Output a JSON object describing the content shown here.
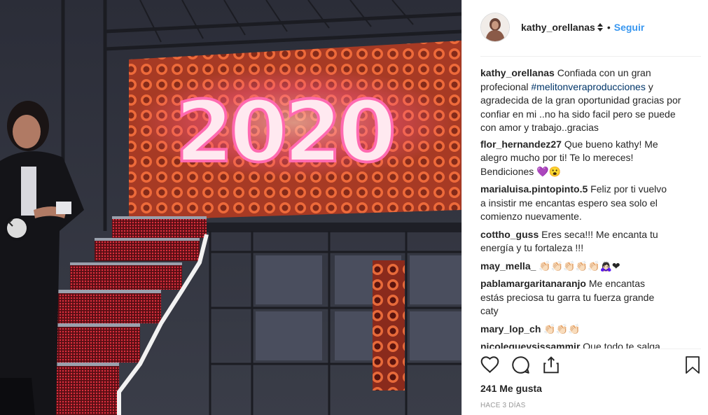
{
  "header": {
    "username": "kathy_orellanas",
    "separator": "•",
    "follow_label": "Seguir"
  },
  "caption": {
    "user": "kathy_orellanas",
    "text_before": "Confiada con un gran profecional",
    "hashtag": "#melitonveraproducciones",
    "text_after": "y agradecida de la gran oportunidad gracias por confiar en mi ..no ha sido facil pero se puede con amor y trabajo..gracias"
  },
  "comments": [
    {
      "user": "flor_hernandez27",
      "text": "Que bueno kathy! Me alegro mucho por ti! Te lo mereces! Bendiciones 💜😮"
    },
    {
      "user": "marialuisa.pintopinto.5",
      "text": "Feliz por ti vuelvo a insistir me encantas espero sea solo el comienzo nuevamente."
    },
    {
      "user": "cottho_guss",
      "text": "Eres seca!!! Me encanta tu energía y tu fortaleza !!!"
    },
    {
      "user": "may_mella_",
      "text": "👏🏻👏🏻👏🏻👏🏻👏🏻🙇🏻‍♀️❤"
    },
    {
      "user": "pablamargaritanaranjo",
      "text": "Me encantas estás preciosa tu garra tu fuerza grande caty"
    },
    {
      "user": "mary_lop_ch",
      "text": "👏🏻👏🏻👏🏻"
    },
    {
      "user": "nicolequevsissammir",
      "text": "Que todo te salga"
    }
  ],
  "stats": {
    "likes": "241 Me gusta",
    "timestamp": "HACE 3 DÍAS"
  },
  "photo": {
    "screen_text": "2020"
  },
  "icons": {
    "like": "heart-icon",
    "comment": "comment-icon",
    "share": "share-icon",
    "save": "bookmark-icon",
    "prev": "chevron-left-icon"
  },
  "colors": {
    "link_blue": "#3897f0",
    "hashtag": "#003569",
    "muted": "#999999"
  }
}
